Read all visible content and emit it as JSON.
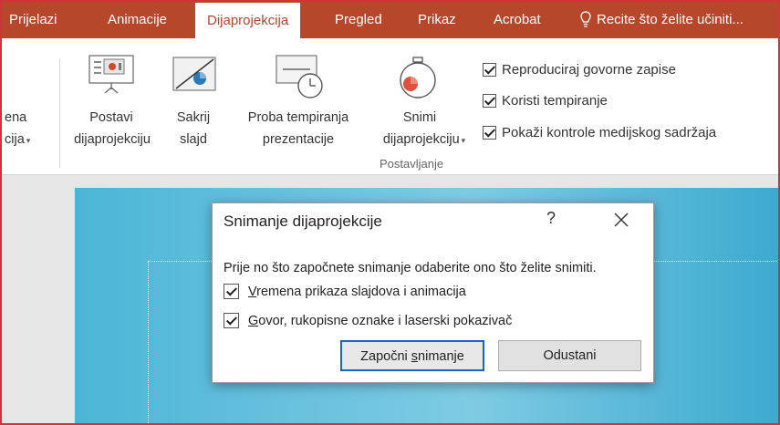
{
  "tabs": [
    {
      "label": "Prijelazi"
    },
    {
      "label": "Animacije"
    },
    {
      "label": "Dijaprojekcija"
    },
    {
      "label": "Pregled"
    },
    {
      "label": "Prikaz"
    },
    {
      "label": "Acrobat"
    }
  ],
  "active_tab": "Dijaprojekcija",
  "tell_me": {
    "label": "Recite što želite učiniti..."
  },
  "ribbon": {
    "cut_off_button": {
      "line1": "ena",
      "line2": "cija"
    },
    "setup_button": {
      "line1": "Postavi",
      "line2": "dijaprojekciju"
    },
    "hide_button": {
      "line1": "Sakrij",
      "line2": "slajd"
    },
    "rehearse_button": {
      "line1": "Proba tempiranja",
      "line2": "prezentacije"
    },
    "record_button": {
      "line1": "Snimi",
      "line2": "dijaprojekciju"
    },
    "checks": [
      {
        "label": "Reproduciraj govorne zapise",
        "checked": true
      },
      {
        "label": "Koristi tempiranje",
        "checked": true
      },
      {
        "label": "Pokaži kontrole medijskog sadržaja",
        "checked": true
      }
    ],
    "group_label": "Postavljanje"
  },
  "dialog": {
    "title": "Snimanje dijaprojekcije",
    "help": "?",
    "prompt": "Prije no što započnete snimanje odaberite ono što želite snimiti.",
    "option1": {
      "first": "V",
      "rest": "remena prikaza slajdova i animacija",
      "checked": true
    },
    "option2": {
      "first": "G",
      "rest": "ovor, rukopisne oznake i laserski pokazivač",
      "checked": true
    },
    "start_button": {
      "before": "Započni ",
      "ul": "s",
      "after": "nimanje"
    },
    "cancel_button": "Odustani"
  },
  "colors": {
    "accent": "#b7472a",
    "frame": "#d13438",
    "slide": "#4cb5d7",
    "focus": "#1a64c8"
  }
}
